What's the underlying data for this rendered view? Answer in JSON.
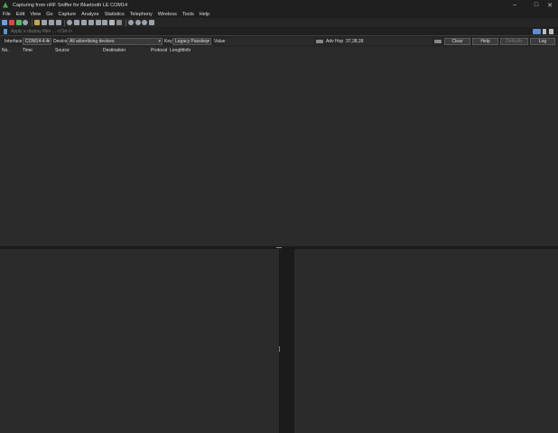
{
  "window": {
    "title": "Capturing from nRF Sniffer for Bluetooth LE COM14",
    "minimize": "–",
    "maximize": "□",
    "close": "✕"
  },
  "menu": [
    "File",
    "Edit",
    "View",
    "Go",
    "Capture",
    "Analyze",
    "Statistics",
    "Telephony",
    "Wireless",
    "Tools",
    "Help"
  ],
  "filter": {
    "placeholder": "Apply a display filter ... <Ctrl-/>"
  },
  "ext": {
    "interface_label": "Interface",
    "interface_value": "COM14-4.4",
    "device_label": "Device",
    "device_value": "All advertising devices",
    "key_label": "Key",
    "key_value": "Legacy Passkey",
    "value_label": "Value",
    "adv_hop_label": "Adv Hop",
    "adv_hop_value": "37,38,39",
    "clear": "Clear",
    "help": "Help",
    "defaults": "Defaults",
    "log": "Log",
    "dropdown_arrow": "▾"
  },
  "columns": [
    "No.",
    "Time",
    "Source",
    "Destination",
    "Protocol",
    "Length",
    "Info"
  ],
  "icons": {
    "toolbar": [
      "shark-fin-start-icon",
      "stop-icon",
      "restart-icon",
      "options-gear-icon",
      "open-folder-icon",
      "save-file-icon",
      "close-file-icon",
      "reload-icon",
      "find-icon",
      "go-back-icon",
      "go-forward-icon",
      "go-to-packet-icon",
      "go-first-icon",
      "go-last-icon",
      "autoscroll-icon",
      "colorize-icon",
      "zoom-in-icon",
      "zoom-out-icon",
      "zoom-reset-icon",
      "resize-columns-icon"
    ]
  },
  "colors": {
    "background": "#2b2b2b",
    "titlebar": "#1f1f1f",
    "accent": "#5a8fd6"
  }
}
